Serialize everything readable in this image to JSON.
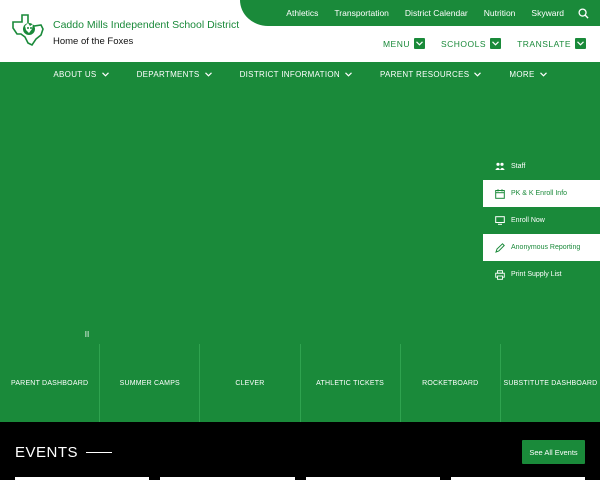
{
  "header": {
    "district_name": "Caddo Mills Independent School District",
    "tagline": "Home of the Foxes",
    "utility_links": [
      "Athletics",
      "Transportation",
      "District Calendar",
      "Nutrition",
      "Skyward"
    ],
    "top_menus": [
      "MENU",
      "SCHOOLS",
      "TRANSLATE"
    ]
  },
  "nav": {
    "items": [
      "ABOUT US",
      "DEPARTMENTS",
      "DISTRICT INFORMATION",
      "PARENT RESOURCES",
      "MORE"
    ]
  },
  "hero": {
    "pause_label": "II"
  },
  "quicklinks": [
    {
      "label": "Staff",
      "icon": "people-icon"
    },
    {
      "label": "PK & K Enroll Info",
      "icon": "calendar-icon"
    },
    {
      "label": "Enroll Now",
      "icon": "screen-icon"
    },
    {
      "label": "Anonymous Reporting",
      "icon": "pencil-icon"
    },
    {
      "label": "Print Supply List",
      "icon": "printer-icon"
    }
  ],
  "tiles": [
    "PARENT DASHBOARD",
    "SUMMER CAMPS",
    "CLEVER",
    "ATHLETIC TICKETS",
    "ROCKETBOARD",
    "SUBSTITUTE DASHBOARD"
  ],
  "events": {
    "title": "EVENTS",
    "see_all_label": "See All Events"
  },
  "colors": {
    "brand_green": "#1a8a3a",
    "white": "#ffffff",
    "black": "#000000"
  }
}
